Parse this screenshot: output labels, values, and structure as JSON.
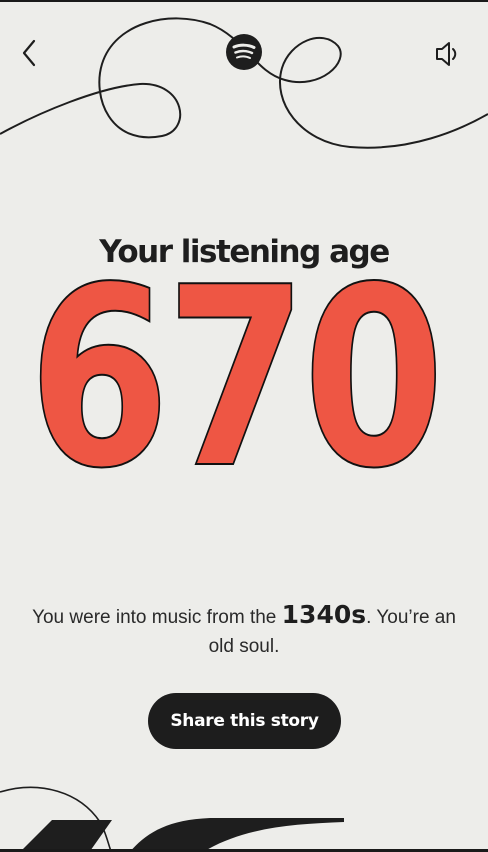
{
  "header": {
    "back_icon": "chevron-left-icon",
    "logo_icon": "spotify-logo-icon",
    "sound_icon": "speaker-icon"
  },
  "story": {
    "title": "Your listening age",
    "age": "670",
    "sentence_before": "You were into music from the ",
    "decade": "1340s",
    "sentence_after": ". You’re an old soul.",
    "share_label": "Share this story"
  },
  "colors": {
    "background": "#ededea",
    "age_fill": "#ee5644",
    "text": "#1e1e1e",
    "button_bg": "#1d1d1d",
    "button_text": "#ffffff"
  }
}
